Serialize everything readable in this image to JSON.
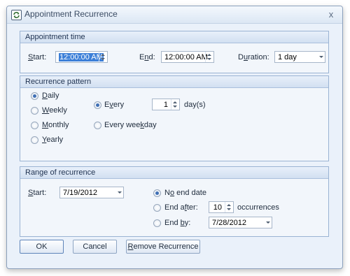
{
  "window": {
    "title": "Appointment Recurrence",
    "close_label": "x"
  },
  "appointment_time": {
    "header": "Appointment time",
    "start_label": "Start:",
    "start_value": "12:00:00 AM",
    "end_label": "End:",
    "end_value": "12:00:00 AM",
    "duration_label": "Duration:",
    "duration_value": "1 day"
  },
  "recurrence_pattern": {
    "header": "Recurrence pattern",
    "options": [
      "Daily",
      "Weekly",
      "Monthly",
      "Yearly"
    ],
    "selected_option": "Daily",
    "every_label": "Every",
    "every_value": "1",
    "every_unit": "day(s)",
    "every_weekday_label": "Every weekday",
    "every_selected": true
  },
  "range": {
    "header": "Range of recurrence",
    "start_label": "Start:",
    "start_value": "7/19/2012",
    "no_end_label": "No end date",
    "end_after_label": "End after:",
    "end_after_value": "10",
    "occurrences_label": "occurrences",
    "end_by_label": "End by:",
    "end_by_value": "7/28/2012",
    "selected": "No end date"
  },
  "buttons": {
    "ok": "OK",
    "cancel": "Cancel",
    "remove": "Remove Recurrence"
  }
}
